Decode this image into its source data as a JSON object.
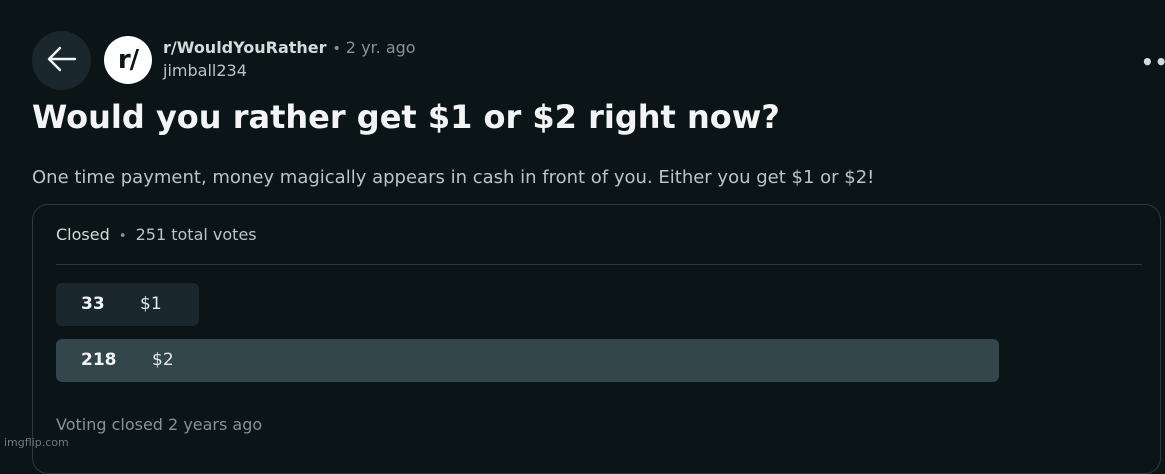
{
  "header": {
    "back_icon": "arrow-left-icon",
    "avatar_text": "r/",
    "subreddit": "r/WouldYouRather",
    "separator": "•",
    "age": "2 yr. ago",
    "author": "jimball234",
    "more_icon": "•••"
  },
  "post": {
    "title": "Would you rather get $1 or $2 right now?",
    "body": "One time payment, money magically appears in cash in front of you. Either you get $1 or $2!"
  },
  "poll": {
    "status": "Closed",
    "separator": "•",
    "total": "251 total votes",
    "options": [
      {
        "count": "33",
        "label": "$1",
        "votes": 33
      },
      {
        "count": "218",
        "label": "$2",
        "votes": 218
      }
    ],
    "closed_note": "Voting closed 2 years ago",
    "colors": {
      "winner": "#33464c",
      "other": "#1a282d"
    }
  },
  "watermark": "imgflip.com"
}
